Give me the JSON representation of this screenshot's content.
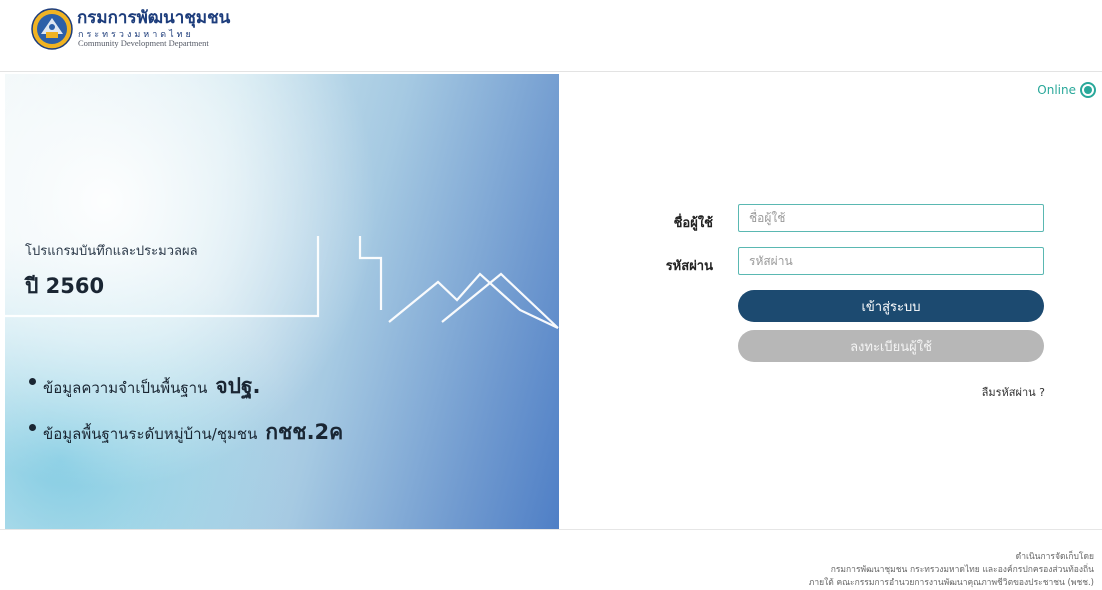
{
  "header": {
    "org_name_th": "กรมการพัฒนาชุมชน",
    "ministry_th": "กระทรวงมหาดไทย",
    "org_name_en": "Community Development Department"
  },
  "banner": {
    "subtitle": "โปรแกรมบันทึกและประมวลผล",
    "year": "ปี 2560",
    "bullets": [
      {
        "text": "ข้อมูลความจำเป็นพื้นฐาน",
        "strong": "จปฐ."
      },
      {
        "text": "ข้อมูลพื้นฐานระดับหมู่บ้าน/ชุมชน",
        "strong": "กชช.2ค"
      }
    ]
  },
  "status": {
    "label": "Online",
    "color": "#29a89a"
  },
  "login": {
    "username_label": "ชื่อผู้ใช้",
    "username_placeholder": "ชื่อผู้ใช้",
    "username_value": "",
    "password_label": "รหัสผ่าน",
    "password_placeholder": "รหัสผ่าน",
    "password_value": "",
    "login_button": "เข้าสู่ระบบ",
    "register_button": "ลงทะเบียนผู้ใช้",
    "forgot_password": "ลืมรหัสผ่าน ?"
  },
  "footer": {
    "lines": [
      "ดำเนินการจัดเก็บโดย",
      "กรมการพัฒนาชุมชน กระทรวงมหาดไทย และองค์กรปกครองส่วนท้องถิ่น",
      "ภายใต้ คณะกรรมการอำนวยการงานพัฒนาคุณภาพชีวิตของประชาชน (พชช.)"
    ]
  },
  "colors": {
    "brand_navy": "#1c4a70",
    "accent_teal": "#5ab8b2",
    "disabled_gray": "#b7b7b7"
  }
}
